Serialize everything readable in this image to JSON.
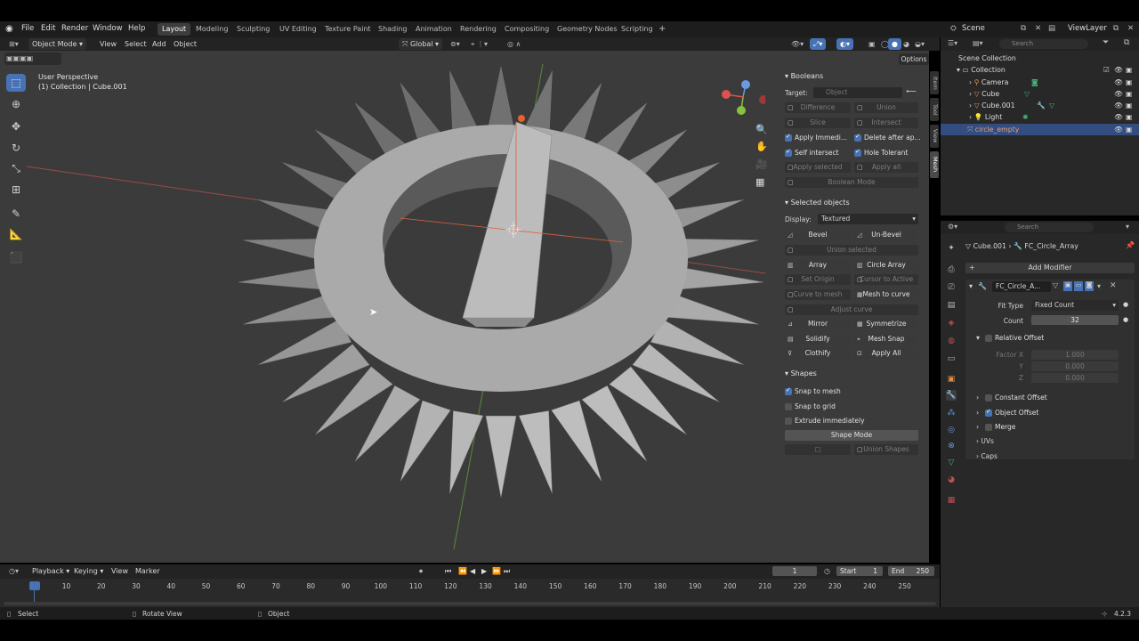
{
  "menus": [
    "File",
    "Edit",
    "Render",
    "Window",
    "Help"
  ],
  "workspaces": [
    "Layout",
    "Modeling",
    "Sculpting",
    "UV Editing",
    "Texture Paint",
    "Shading",
    "Animation",
    "Rendering",
    "Compositing",
    "Geometry Nodes",
    "Scripting"
  ],
  "plus": "+",
  "scene": "Scene",
  "view_layer": "ViewLayer",
  "header": {
    "mode": "Object Mode",
    "view": "View",
    "select": "Select",
    "add": "Add",
    "object": "Object",
    "orientation": "Global",
    "options": "Options"
  },
  "viewport": {
    "perspective": "User Perspective",
    "collection": "(1) Collection | Cube.001"
  },
  "sidebar_tabs": [
    "Item",
    "Tool",
    "View",
    "Mesh"
  ],
  "booleans": {
    "title": "Booleans",
    "target_label": "Target:",
    "target_placeholder": "Object",
    "difference": "Difference",
    "union": "Union",
    "slice": "Slice",
    "intersect": "Intersect",
    "apply_immediately": "Apply Immedi...",
    "delete_after": "Delete after ap...",
    "self_intersect": "Self intersect",
    "hole_tolerant": "Hole Tolerant",
    "apply_selected": "Apply selected",
    "apply_all": "Apply all",
    "boolean_mode": "Boolean Mode"
  },
  "selected_objects": {
    "title": "Selected objects",
    "display_label": "Display:",
    "display_value": "Textured",
    "bevel": "Bevel",
    "unbevel": "Un-Bevel",
    "union_selected": "Union selected",
    "array": "Array",
    "circle_array": "Circle Array",
    "set_origin": "Set Origin",
    "cursor_to_active": "Cursor to Active",
    "curve_to_mesh": "Curve to mesh",
    "mesh_to_curve": "Mesh to curve",
    "adjust_curve": "Adjust curve",
    "mirror": "Mirror",
    "symmetrize": "Symmetrize",
    "solidify": "Solidify",
    "mesh_snap": "Mesh Snap",
    "clothify": "Clothify",
    "apply_all": "Apply All"
  },
  "shapes": {
    "title": "Shapes",
    "snap_to_mesh": "Snap to mesh",
    "snap_to_grid": "Snap to grid",
    "extrude_immediately": "Extrude immediately",
    "shape_mode": "Shape Mode",
    "union_shapes": "Union Shapes"
  },
  "outliner": {
    "search": "Search",
    "scene_collection": "Scene Collection",
    "collection": "Collection",
    "items": [
      "Camera",
      "Cube",
      "Cube.001",
      "Light",
      "circle_empty"
    ]
  },
  "properties": {
    "search": "Search",
    "object": "Cube.001",
    "modifier_name": "FC_Circle_Array",
    "add_modifier": "Add Modifier",
    "modifier_short": "FC_Circle_A...",
    "fit_type_label": "Fit Type",
    "fit_type": "Fixed Count",
    "count_label": "Count",
    "count": "32",
    "relative_offset": "Relative Offset",
    "factor_x_label": "Factor X",
    "factor_x": "1.000",
    "y_label": "Y",
    "y": "0.000",
    "z_label": "Z",
    "z": "0.000",
    "constant_offset": "Constant Offset",
    "object_offset": "Object Offset",
    "merge": "Merge",
    "uvs": "UVs",
    "caps": "Caps"
  },
  "timeline": {
    "playback": "Playback",
    "keying": "Keying",
    "view": "View",
    "marker": "Marker",
    "current_frame": "1",
    "start_label": "Start",
    "start": "1",
    "end_label": "End",
    "end": "250",
    "ticks": [
      "1",
      "10",
      "20",
      "30",
      "40",
      "50",
      "60",
      "70",
      "80",
      "90",
      "100",
      "110",
      "120",
      "130",
      "140",
      "150",
      "160",
      "170",
      "180",
      "190",
      "200",
      "210",
      "220",
      "230",
      "240",
      "250"
    ]
  },
  "status": {
    "select": "Select",
    "rotate_view": "Rotate View",
    "object": "Object",
    "version": "4.2.3"
  },
  "colors": {
    "accent": "#4772b3",
    "active_object": "#f0a050",
    "selected_text": "#e8a07a"
  }
}
